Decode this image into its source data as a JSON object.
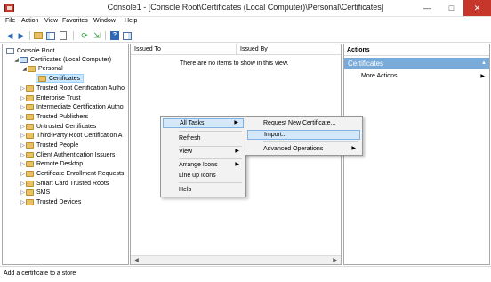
{
  "window": {
    "title": "Console1 - [Console Root\\Certificates (Local Computer)\\Personal\\Certificates]",
    "min_glyph": "—",
    "max_glyph": "□",
    "close_glyph": "✕"
  },
  "menubar": [
    "File",
    "Action",
    "View",
    "Favorites",
    "Window",
    "Help"
  ],
  "toolbar": {
    "buttons": [
      "back-icon",
      "forward-icon",
      "up-folder-icon",
      "show-hide-tree-icon",
      "properties-icon",
      "refresh-icon",
      "export-list-icon",
      "help-icon",
      "show-hide-action-pane-icon"
    ]
  },
  "tree": {
    "items": [
      {
        "label": "Console Root",
        "icon": "console-icon",
        "arrow": ""
      },
      {
        "label": "Certificates (Local Computer)",
        "icon": "computer-icon",
        "arrow": "◢"
      },
      {
        "label": "Personal",
        "icon": "folder-icon",
        "arrow": "◢"
      },
      {
        "label": "Certificates",
        "icon": "folder-icon",
        "arrow": ""
      },
      {
        "label": "Trusted Root Certification Autho",
        "icon": "folder-icon",
        "arrow": "▷"
      },
      {
        "label": "Enterprise Trust",
        "icon": "folder-icon",
        "arrow": "▷"
      },
      {
        "label": "Intermediate Certification Autho",
        "icon": "folder-icon",
        "arrow": "▷"
      },
      {
        "label": "Trusted Publishers",
        "icon": "folder-icon",
        "arrow": "▷"
      },
      {
        "label": "Untrusted Certificates",
        "icon": "folder-icon",
        "arrow": "▷"
      },
      {
        "label": "Third-Party Root Certification A",
        "icon": "folder-icon",
        "arrow": "▷"
      },
      {
        "label": "Trusted People",
        "icon": "folder-icon",
        "arrow": "▷"
      },
      {
        "label": "Client Authentication Issuers",
        "icon": "folder-icon",
        "arrow": "▷"
      },
      {
        "label": "Remote Desktop",
        "icon": "folder-icon",
        "arrow": "▷"
      },
      {
        "label": "Certificate Enrollment Requests",
        "icon": "folder-icon",
        "arrow": "▷"
      },
      {
        "label": "Smart Card Trusted Roots",
        "icon": "folder-icon",
        "arrow": "▷"
      },
      {
        "label": "SMS",
        "icon": "folder-icon",
        "arrow": "▷"
      },
      {
        "label": "Trusted Devices",
        "icon": "folder-icon",
        "arrow": "▷"
      }
    ]
  },
  "center": {
    "columns": [
      "Issued To",
      "Issued By"
    ],
    "empty_message": "There are no items to show in this view.",
    "scroll_left": "◀",
    "scroll_right": "▶"
  },
  "actions": {
    "title": "Actions",
    "section": "Certificates",
    "section_caret": "▲",
    "more": "More Actions",
    "more_arrow": "▶"
  },
  "context_menu": {
    "items": [
      "All Tasks",
      "Refresh",
      "View",
      "Arrange Icons",
      "Line up Icons",
      "Help"
    ],
    "arrow": "▶"
  },
  "submenu": {
    "items": [
      "Request New Certificate...",
      "Import...",
      "Advanced Operations"
    ],
    "arrow": "▶"
  },
  "status": "Add a certificate to a store",
  "colors": {
    "accent": "#7aaad8",
    "highlight": "#cce8ff",
    "close": "#c7362b"
  }
}
